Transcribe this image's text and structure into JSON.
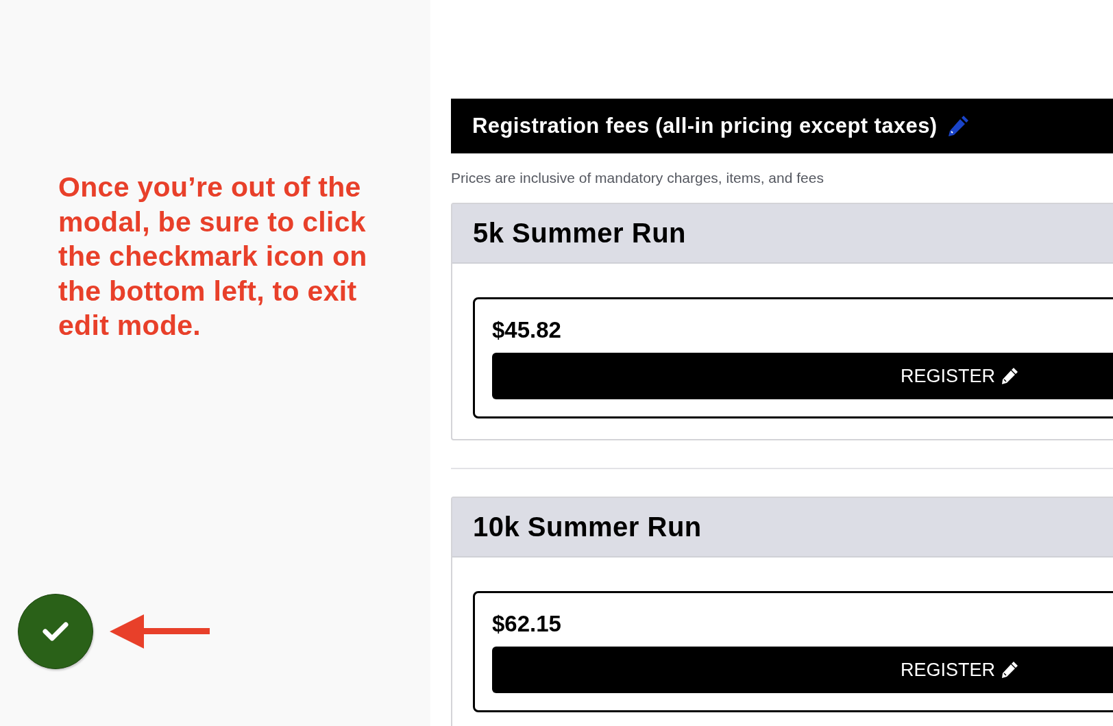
{
  "note": {
    "text": "Once you’re out of the modal, be sure to click the checkmark icon on the bottom left, to exit edit mode."
  },
  "section": {
    "title": "Registration fees (all-in pricing except taxes)",
    "subtitle": "Prices are inclusive of mandatory charges, items, and fees"
  },
  "events": [
    {
      "name": "5k Summer Run",
      "price": "$45.82",
      "button": "REGISTER"
    },
    {
      "name": "10k Summer Run",
      "price": "$62.15",
      "button": "REGISTER"
    }
  ]
}
